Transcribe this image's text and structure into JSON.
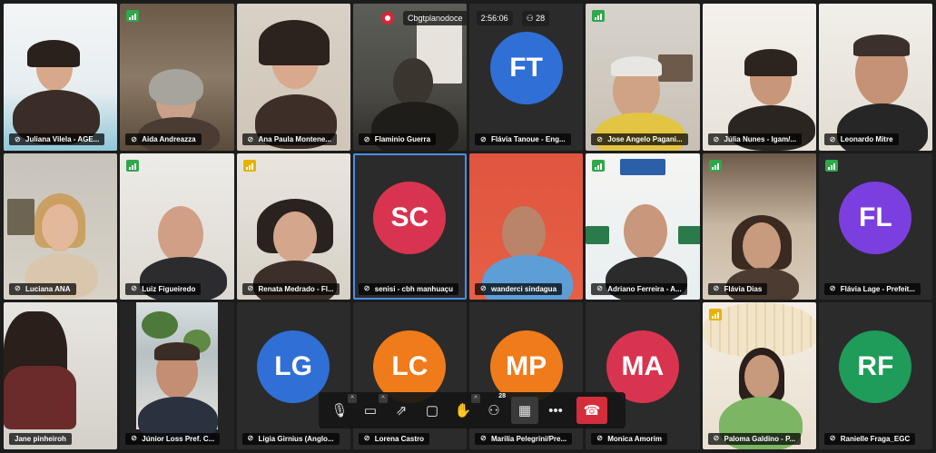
{
  "meeting": {
    "title": "Cbgtplanodoce",
    "timer": "2:56:06",
    "participant_count": "28"
  },
  "colors": {
    "tile_active_border": "#4a8fe7",
    "signal_good": "#2ea84b",
    "signal_fair": "#e7b300",
    "end_call": "#d42d3b"
  },
  "participants": [
    {
      "name": "Juliana Vilela - AGE...",
      "type": "video"
    },
    {
      "name": "Aida Andreazza",
      "type": "video"
    },
    {
      "name": "Ana Paula Montene...",
      "type": "video"
    },
    {
      "name": "Flaminio Guerra",
      "type": "video"
    },
    {
      "name": "Flávia Tanoue - Eng...",
      "type": "avatar",
      "initials": "FT",
      "color": "#2f6fd6"
    },
    {
      "name": "Jose Angelo Pagani...",
      "type": "video"
    },
    {
      "name": "Júlia Nunes - Igam/...",
      "type": "video"
    },
    {
      "name": "Leonardo Mitre",
      "type": "video"
    },
    {
      "name": "Luciana ANA",
      "type": "video"
    },
    {
      "name": "Luiz Figueiredo",
      "type": "video"
    },
    {
      "name": "Renata Medrado - Fl...",
      "type": "video"
    },
    {
      "name": "senisi - cbh manhuaçu",
      "type": "avatar",
      "initials": "SC",
      "color": "#d9344f"
    },
    {
      "name": "wanderci sindagua",
      "type": "video"
    },
    {
      "name": "Adriano Ferreira - A...",
      "type": "video"
    },
    {
      "name": "Flávia Dias",
      "type": "video"
    },
    {
      "name": "Flávia Lage - Prefeit...",
      "type": "avatar",
      "initials": "FL",
      "color": "#7b3fe0"
    },
    {
      "name": "Jane pinheiroh",
      "type": "video"
    },
    {
      "name": "Júnior Loss Pref. C...",
      "type": "video"
    },
    {
      "name": "Ligia Girnius (Anglo...",
      "type": "avatar",
      "initials": "LG",
      "color": "#2f6fd6"
    },
    {
      "name": "Lorena Castro",
      "type": "avatar",
      "initials": "LC",
      "color": "#f07b1a"
    },
    {
      "name": "Marilia Pelegrini/Pre...",
      "type": "avatar",
      "initials": "MP",
      "color": "#f07b1a"
    },
    {
      "name": "Monica Amorim",
      "type": "avatar",
      "initials": "MA",
      "color": "#d9344f"
    },
    {
      "name": "Paloma Galdino - P...",
      "type": "video"
    },
    {
      "name": "Ranielle Fraga_EGC",
      "type": "avatar",
      "initials": "RF",
      "color": "#1f9b5a"
    }
  ],
  "toolbar": {
    "participants_count": "28",
    "icons": [
      "mic-muted-icon",
      "camera-icon",
      "share-screen-icon",
      "chat-icon",
      "raise-hand-icon",
      "participants-icon",
      "grid-view-icon",
      "more-icon",
      "end-call-icon"
    ]
  }
}
